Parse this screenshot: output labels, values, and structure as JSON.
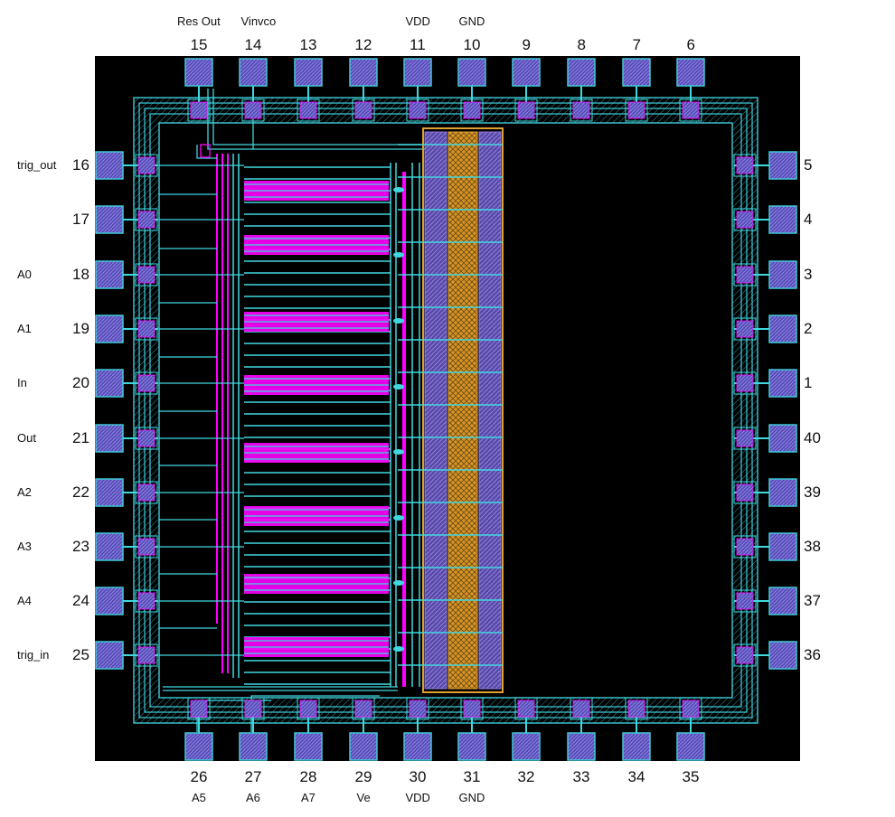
{
  "top_pins": [
    {
      "number": "15",
      "signal": "Res Out"
    },
    {
      "number": "14",
      "signal": "Vinvco"
    },
    {
      "number": "13",
      "signal": ""
    },
    {
      "number": "12",
      "signal": ""
    },
    {
      "number": "11",
      "signal": "VDD"
    },
    {
      "number": "10",
      "signal": "GND"
    },
    {
      "number": "9",
      "signal": ""
    },
    {
      "number": "8",
      "signal": ""
    },
    {
      "number": "7",
      "signal": ""
    },
    {
      "number": "6",
      "signal": ""
    }
  ],
  "bottom_pins": [
    {
      "number": "26",
      "signal": "A5"
    },
    {
      "number": "27",
      "signal": "A6"
    },
    {
      "number": "28",
      "signal": "A7"
    },
    {
      "number": "29",
      "signal": "Ve"
    },
    {
      "number": "30",
      "signal": "VDD"
    },
    {
      "number": "31",
      "signal": "GND"
    },
    {
      "number": "32",
      "signal": ""
    },
    {
      "number": "33",
      "signal": ""
    },
    {
      "number": "34",
      "signal": ""
    },
    {
      "number": "35",
      "signal": ""
    }
  ],
  "left_pins": [
    {
      "number": "16",
      "signal": "trig_out"
    },
    {
      "number": "17",
      "signal": ""
    },
    {
      "number": "18",
      "signal": "A0"
    },
    {
      "number": "19",
      "signal": "A1"
    },
    {
      "number": "20",
      "signal": "In"
    },
    {
      "number": "21",
      "signal": "Out"
    },
    {
      "number": "22",
      "signal": "A2"
    },
    {
      "number": "23",
      "signal": "A3"
    },
    {
      "number": "24",
      "signal": "A4"
    },
    {
      "number": "25",
      "signal": "trig_in"
    }
  ],
  "right_pins": [
    {
      "number": "5",
      "signal": ""
    },
    {
      "number": "4",
      "signal": ""
    },
    {
      "number": "3",
      "signal": ""
    },
    {
      "number": "2",
      "signal": ""
    },
    {
      "number": "1",
      "signal": ""
    },
    {
      "number": "40",
      "signal": ""
    },
    {
      "number": "39",
      "signal": ""
    },
    {
      "number": "38",
      "signal": ""
    },
    {
      "number": "37",
      "signal": ""
    },
    {
      "number": "36",
      "signal": ""
    }
  ],
  "colors": {
    "background": "#000000",
    "pad_fill": "#5a50b4",
    "pad_border": "#40c8d8",
    "cyan_metal": "#40d8e0",
    "magenta_poly": "#ff00ff",
    "power_rail_orange": "#e0a030",
    "power_rail_purple": "#6a5ab8"
  }
}
